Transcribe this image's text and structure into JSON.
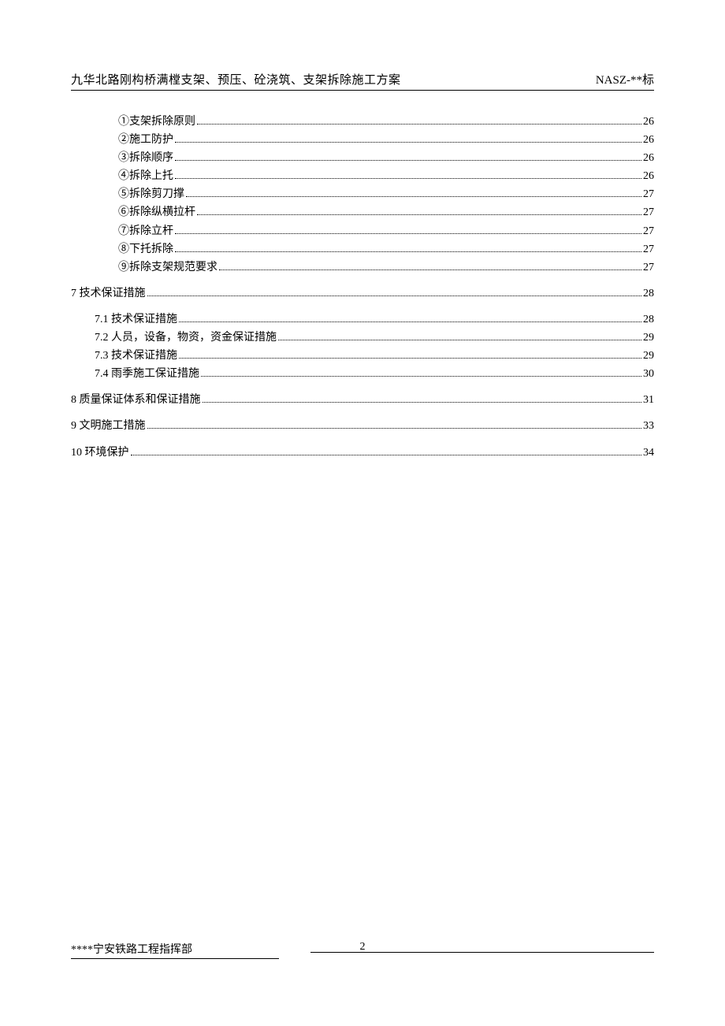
{
  "header": {
    "title_left": "九华北路刚构桥满樘支架、预压、砼浇筑、支架拆除施工方案",
    "title_right": "NASZ-**标"
  },
  "toc": [
    {
      "indent": 3,
      "label": "①支架拆除原则",
      "page": "26",
      "gap": false
    },
    {
      "indent": 3,
      "label": "②施工防护",
      "page": "26",
      "gap": false
    },
    {
      "indent": 3,
      "label": "③拆除顺序",
      "page": "26",
      "gap": false
    },
    {
      "indent": 3,
      "label": "④拆除上托",
      "page": "26",
      "gap": false
    },
    {
      "indent": 3,
      "label": "⑤拆除剪刀撑",
      "page": "27",
      "gap": false
    },
    {
      "indent": 3,
      "label": "⑥拆除纵横拉杆",
      "page": "27",
      "gap": false
    },
    {
      "indent": 3,
      "label": "⑦拆除立杆",
      "page": "27",
      "gap": false
    },
    {
      "indent": 3,
      "label": "⑧下托拆除",
      "page": "27",
      "gap": false
    },
    {
      "indent": 3,
      "label": "⑨拆除支架规范要求",
      "page": "27",
      "gap": false
    },
    {
      "indent": 1,
      "label": "7 技术保证措施",
      "page": "28",
      "gap": true
    },
    {
      "indent": 2,
      "label": "7.1 技术保证措施",
      "page": "28",
      "gap": true
    },
    {
      "indent": 2,
      "label": "7.2 人员，设备，物资，资金保证措施",
      "page": "29",
      "gap": false
    },
    {
      "indent": 2,
      "label": "7.3 技术保证措施",
      "page": "29",
      "gap": false
    },
    {
      "indent": 2,
      "label": "7.4 雨季施工保证措施",
      "page": "30",
      "gap": false
    },
    {
      "indent": 1,
      "label": "8 质量保证体系和保证措施",
      "page": "31",
      "gap": true
    },
    {
      "indent": 1,
      "label": "9 文明施工措施",
      "page": "33",
      "gap": true
    },
    {
      "indent": 1,
      "label": "10 环境保护",
      "page": "34",
      "gap": true
    }
  ],
  "footer": {
    "left": "****宁安铁路工程指挥部",
    "page_number": "2"
  }
}
